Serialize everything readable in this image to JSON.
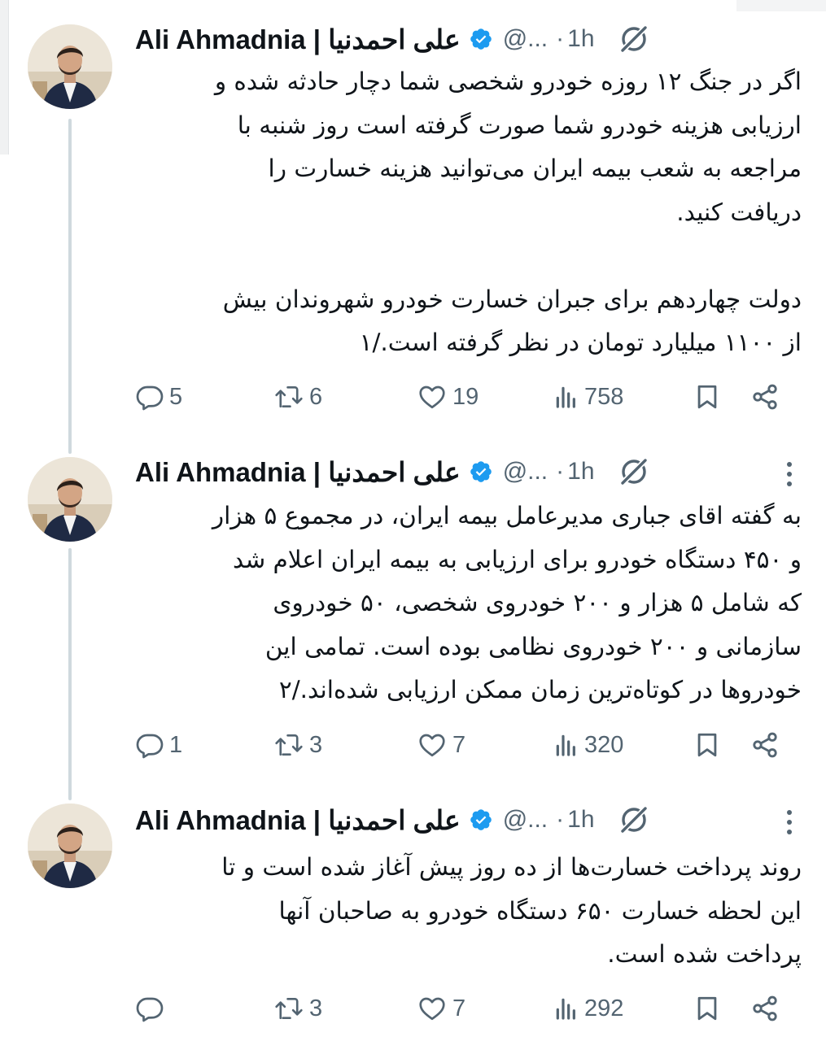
{
  "tweets": [
    {
      "author_name": "Ali Ahmadnia | علی احمدنیا",
      "handle": "@...",
      "time": "1h",
      "text": "اگر در جنگ ۱۲ روزه خودرو شخصی شما دچار حادثه شده و\nارزیابی هزینه خودرو شما صورت گرفته است روز شنبه با\nمراجعه به شعب بیمه ایران می‌توانید هزینه خسارت را\nدریافت کنید.\n\nدولت چهاردهم برای جبران خسارت خودرو شهروندان بیش\nاز ۱۱۰۰ میلیارد تومان در نظر گرفته است./۱",
      "replies": "5",
      "reposts": "6",
      "likes": "19",
      "views": "758"
    },
    {
      "author_name": "Ali Ahmadnia | علی احمدنیا",
      "handle": "@...",
      "time": "1h",
      "text": "به گفته اقای جباری مدیرعامل بیمه ایران، در مجموع ۵ هزار\nو ۴۵۰ دستگاه خودرو برای ارزیابی به بیمه ایران اعلام شد\nکه شامل ۵ هزار و ۲۰۰ خودروی شخصی، ۵۰ خودروی\nسازمانی و ۲۰۰ خودروی نظامی بوده است. تمامی این\nخودروها در کوتاه‌ترین زمان ممکن ارزیابی شده‌اند./۲",
      "replies": "1",
      "reposts": "3",
      "likes": "7",
      "views": "320"
    },
    {
      "author_name": "Ali Ahmadnia | علی احمدنیا",
      "handle": "@...",
      "time": "1h",
      "text": "روند پرداخت خسارت‌ها از ده روز پیش آغاز شده است و تا\nاین لحظه خسارت ۶۵۰ دستگاه خودرو به صاحبان آنها\nپرداخت شده است.",
      "replies": "",
      "reposts": "3",
      "likes": "7",
      "views": "292"
    }
  ],
  "dot_separator": "·",
  "icons": {
    "verified": "verified-badge-icon",
    "grok": "grok-icon",
    "more": "more-icon",
    "reply": "reply-icon",
    "repost": "repost-icon",
    "like": "like-icon",
    "views": "views-icon",
    "bookmark": "bookmark-icon",
    "share": "share-icon"
  },
  "colors": {
    "text": "#0f1419",
    "secondary": "#536471",
    "verified": "#1d9bf0",
    "thread_line": "#cfd9de"
  }
}
